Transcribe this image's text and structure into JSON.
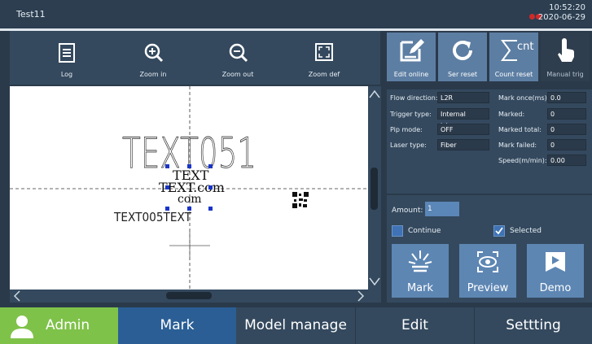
{
  "window": {
    "title": "Test11",
    "time": "10:52:20",
    "date": "2020-06-29"
  },
  "toolbar": [
    {
      "label": "Log",
      "icon": "log-icon"
    },
    {
      "label": "Zoom in",
      "icon": "zoom-in-icon"
    },
    {
      "label": "Zoom out",
      "icon": "zoom-out-icon"
    },
    {
      "label": "Zoom def",
      "icon": "zoom-default-icon"
    }
  ],
  "canvas": {
    "big_text": "TEXT051",
    "text_obj": "TEXT",
    "text_obj2": "TEXT.com",
    "text_obj3": "com",
    "small_text": "TEXT005TEXT"
  },
  "right_buttons": [
    {
      "label": "Edit online",
      "icon": "edit-online-icon"
    },
    {
      "label": "Ser reset",
      "icon": "refresh-icon"
    },
    {
      "label": "Count reset",
      "icon": "sigma-count-icon",
      "glyph": "cnt"
    },
    {
      "label": "Manual trig",
      "icon": "hand-pointer-icon"
    }
  ],
  "params": {
    "flow_direction": {
      "label": "Flow direction:",
      "value": "L2R"
    },
    "trigger_type": {
      "label": "Trigger type:",
      "value": "Internal trigger"
    },
    "pip_mode": {
      "label": "Pip mode:",
      "value": "OFF"
    },
    "laser_type": {
      "label": "Laser type:",
      "value": "Fiber"
    },
    "mark_once": {
      "label": "Mark once(ms):",
      "value": "0.0"
    },
    "marked": {
      "label": "Marked:",
      "value": "0"
    },
    "marked_total": {
      "label": "Marked total:",
      "value": "0"
    },
    "mark_failed": {
      "label": "Mark failed:",
      "value": "0"
    },
    "speed": {
      "label": "Speed(m/min):",
      "value": "0.00"
    }
  },
  "controls": {
    "amount_label": "Amount:",
    "amount_value": "1",
    "continue_label": "Continue",
    "continue_checked": false,
    "selected_label": "Selected",
    "selected_checked": true,
    "mark_label": "Mark",
    "preview_label": "Preview",
    "demo_label": "Demo"
  },
  "nav": {
    "admin": "Admin",
    "mark": "Mark",
    "model_manage": "Model manage",
    "edit": "Edit",
    "setting": "Settting"
  },
  "colors": {
    "accent": "#5d86b3",
    "admin": "#7fc24a",
    "active_tab": "#2a5e95",
    "alarm": "#d12a2a"
  }
}
